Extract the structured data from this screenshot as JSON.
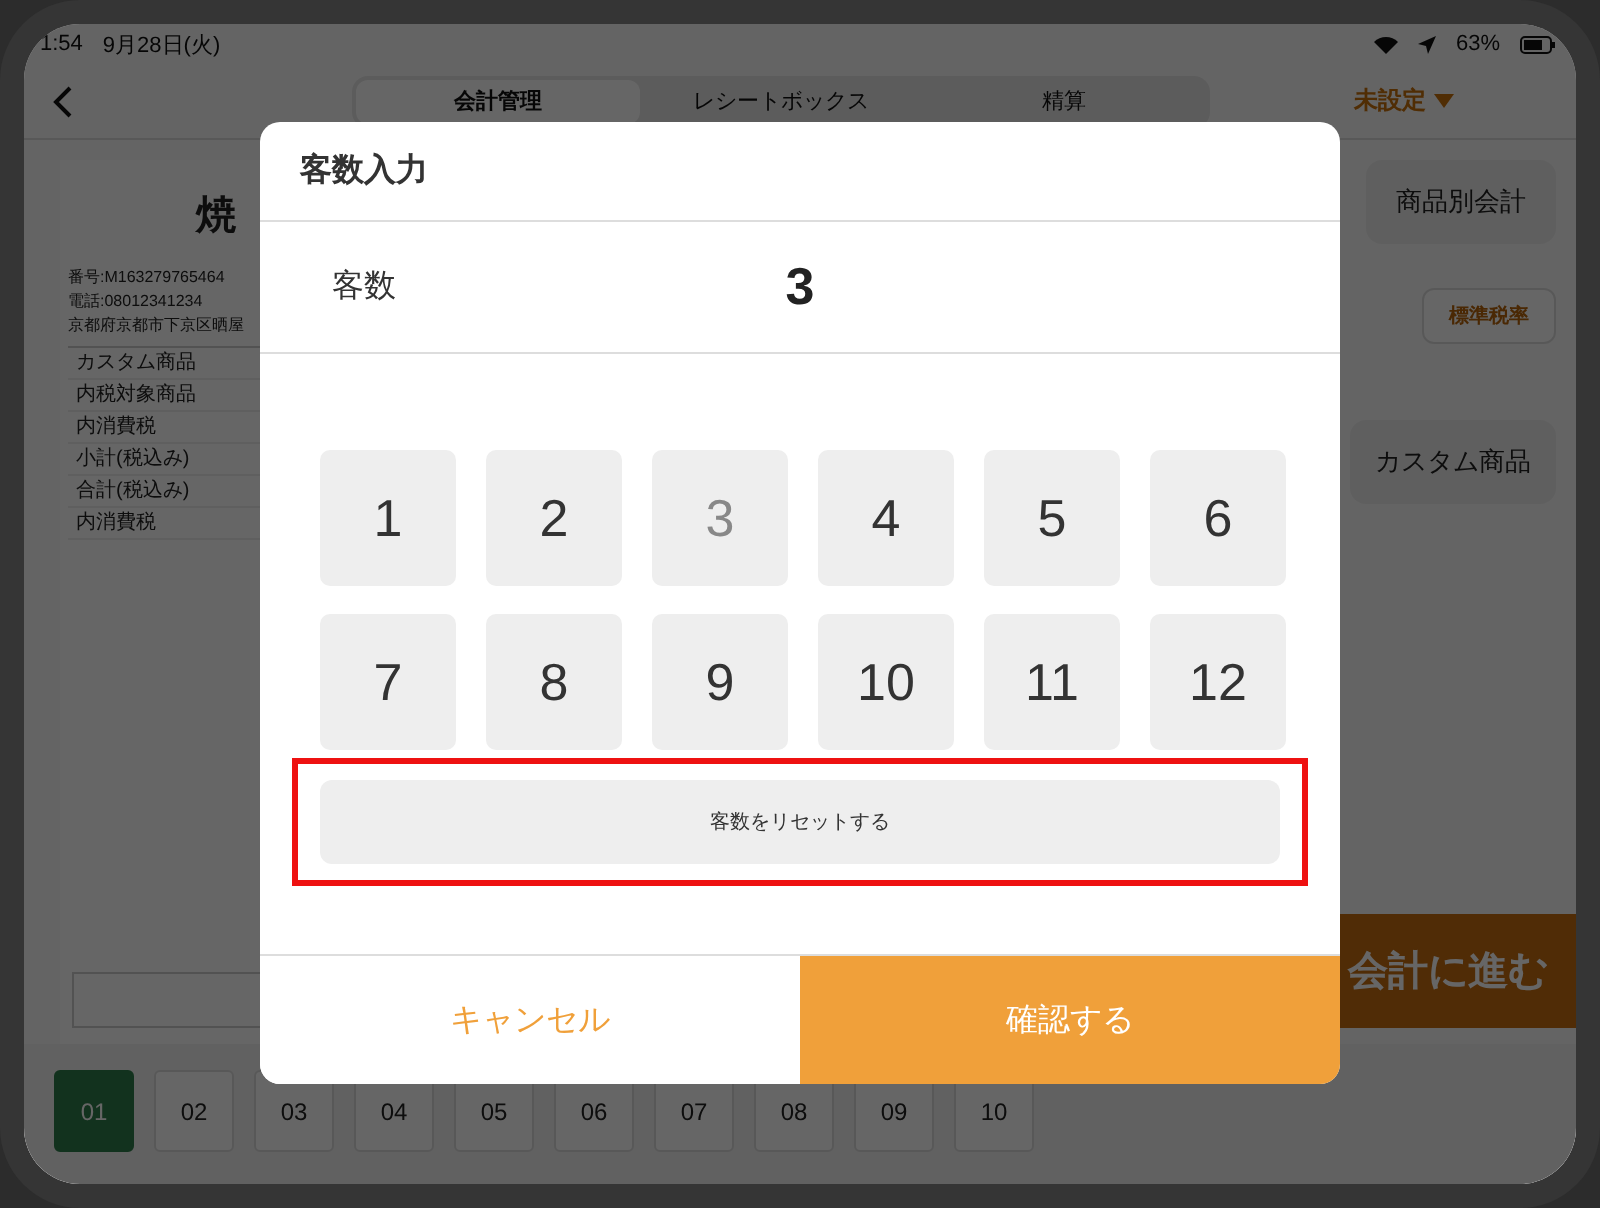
{
  "status_bar": {
    "time": "1:54",
    "date": "9月28日(火)",
    "battery": "63%"
  },
  "header": {
    "tabs": [
      {
        "label": "会計管理",
        "selected": true
      },
      {
        "label": "レシートボックス",
        "selected": false
      },
      {
        "label": "精算",
        "selected": false
      }
    ],
    "store_selector": "未設定"
  },
  "receipt": {
    "title": "焼",
    "info": [
      "番号:M163279765464",
      "電話:08012341234",
      "京都府京都市下京区晒屋"
    ],
    "lines": [
      "カスタム商品",
      "内税対象商品",
      "内消費税",
      "小計(税込み)",
      "合計(税込み)",
      "内消費税"
    ]
  },
  "product_checkout_button": "商品別会計",
  "tax_rate_button": "標準税率",
  "custom_item_button": "カスタム商品",
  "proceed_button": "会計に進む",
  "tables": [
    {
      "label": "01",
      "selected": true
    },
    {
      "label": "02",
      "selected": false
    },
    {
      "label": "03",
      "selected": false
    },
    {
      "label": "04",
      "selected": false
    },
    {
      "label": "05",
      "selected": false
    },
    {
      "label": "06",
      "selected": false
    },
    {
      "label": "07",
      "selected": false
    },
    {
      "label": "08",
      "selected": false
    },
    {
      "label": "09",
      "selected": false
    },
    {
      "label": "10",
      "selected": false
    }
  ],
  "dialog": {
    "title": "客数入力",
    "field_label": "客数",
    "value": "3",
    "keys": [
      {
        "label": "1",
        "selected": false
      },
      {
        "label": "2",
        "selected": false
      },
      {
        "label": "3",
        "selected": true
      },
      {
        "label": "4",
        "selected": false
      },
      {
        "label": "5",
        "selected": false
      },
      {
        "label": "6",
        "selected": false
      },
      {
        "label": "7",
        "selected": false
      },
      {
        "label": "8",
        "selected": false
      },
      {
        "label": "9",
        "selected": false
      },
      {
        "label": "10",
        "selected": false
      },
      {
        "label": "11",
        "selected": false
      },
      {
        "label": "12",
        "selected": false
      }
    ],
    "reset_button": "客数をリセットする",
    "cancel_button": "キャンセル",
    "confirm_button": "確認する"
  }
}
